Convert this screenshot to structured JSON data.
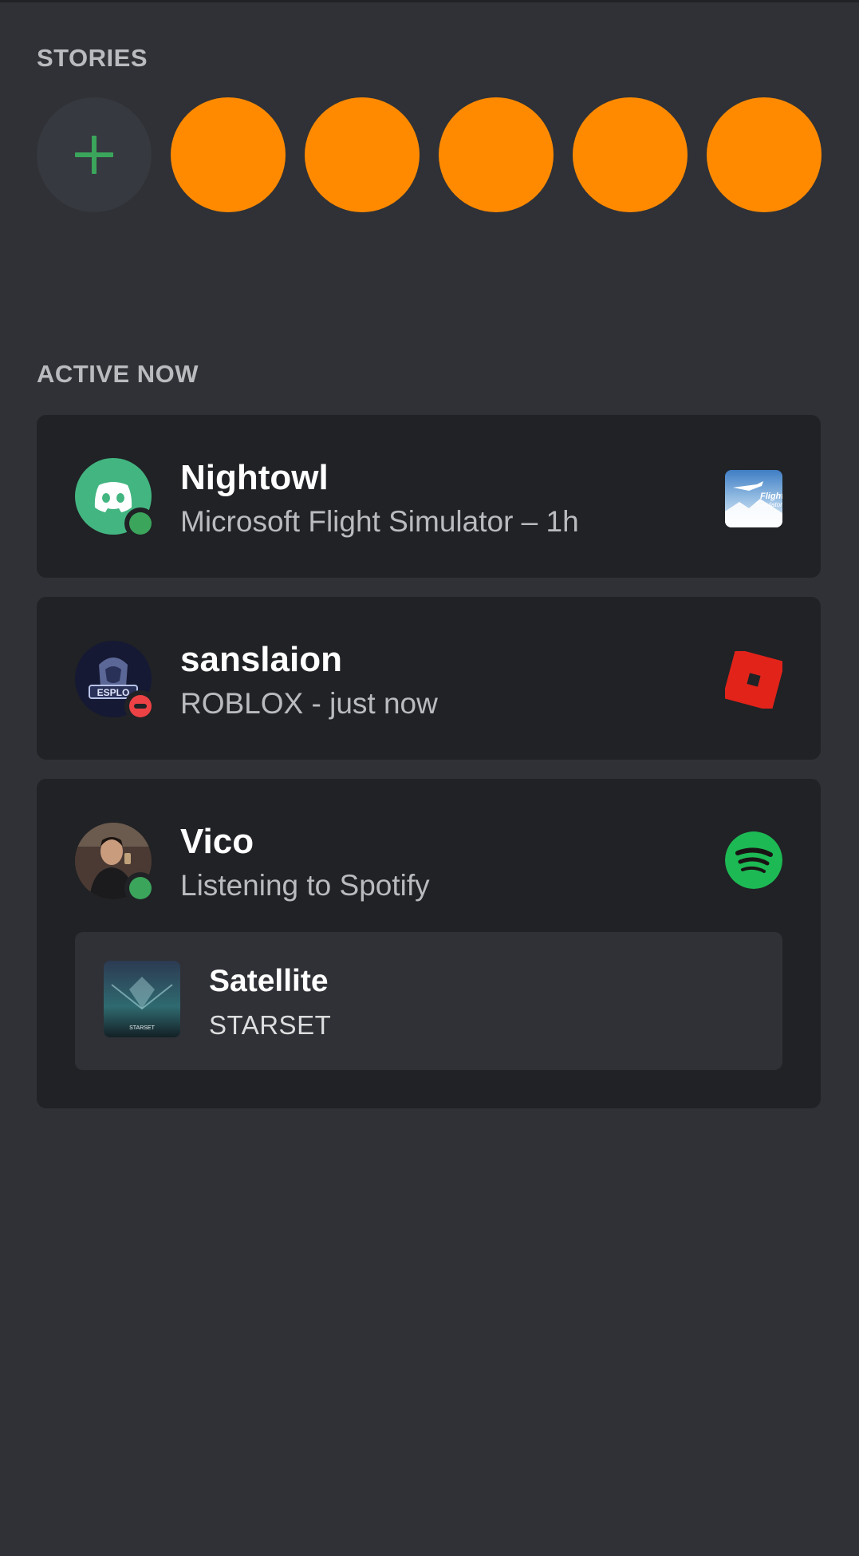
{
  "sections": {
    "stories_title": "STORIES",
    "active_now_title": "ACTIVE NOW"
  },
  "stories": {
    "add_icon": "plus-icon",
    "story_color": "#ff8a00",
    "count": 5
  },
  "activities": [
    {
      "name": "Nightowl",
      "activity": "Microsoft Flight Simulator – 1h",
      "status": "online",
      "avatar_icon": "discord-logo-icon",
      "app_icon": "flight-simulator-icon"
    },
    {
      "name": "sanslaion",
      "activity": "ROBLOX - just now",
      "status": "do-not-disturb",
      "avatar_icon": "esports-logo-avatar",
      "app_icon": "roblox-icon"
    },
    {
      "name": "Vico",
      "activity": "Listening to Spotify",
      "status": "online",
      "avatar_icon": "user-photo-avatar",
      "app_icon": "spotify-icon",
      "track": {
        "title": "Satellite",
        "artist": "STARSET",
        "album_art_text": "STARSET"
      }
    }
  ],
  "colors": {
    "background": "#2f3136",
    "card": "#202225",
    "online": "#3ba55c",
    "dnd": "#ed4245",
    "spotify": "#1db954",
    "roblox": "#e2231a",
    "accent_green": "#3ba55c"
  }
}
